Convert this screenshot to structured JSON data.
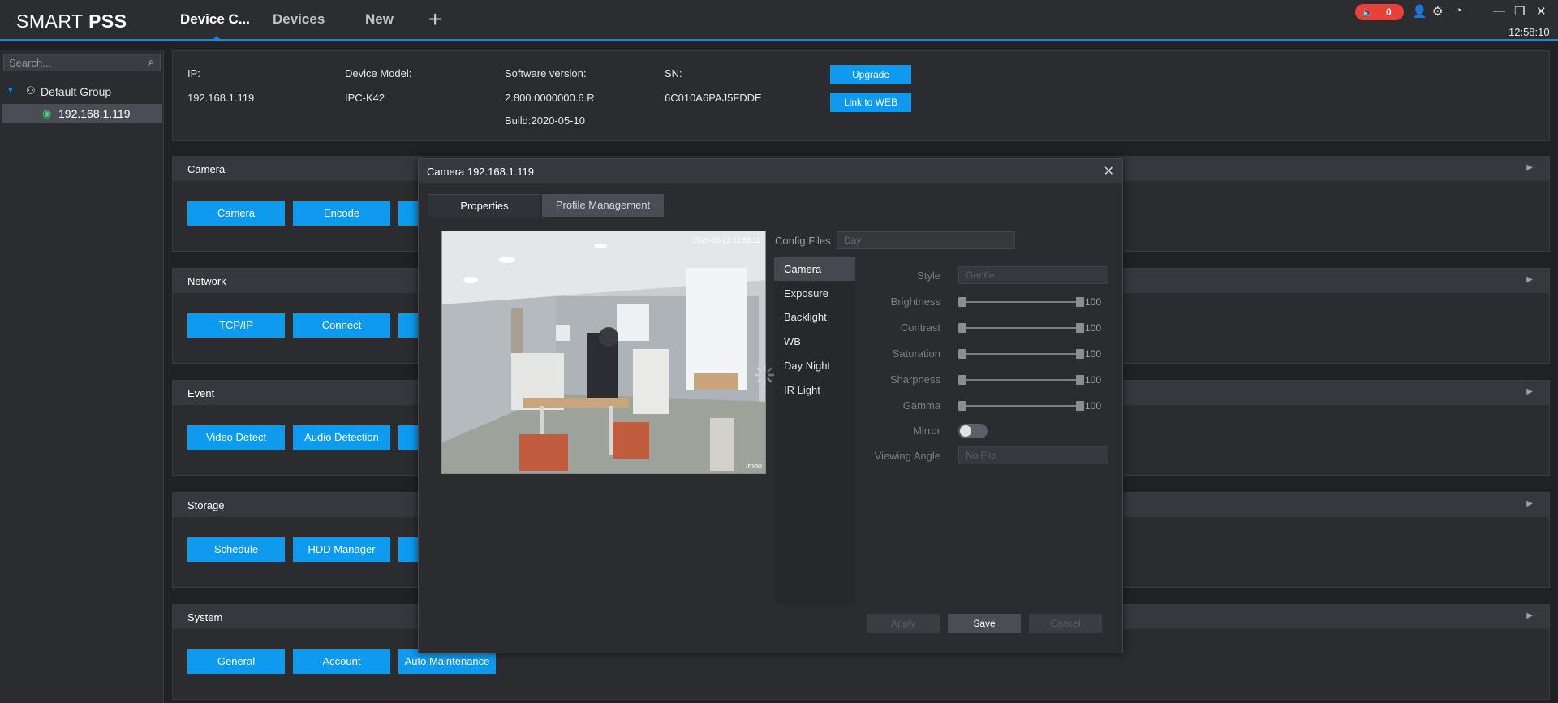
{
  "app": {
    "logo_light": "SMART ",
    "logo_bold": "PSS",
    "tabs": [
      {
        "label": "Device C..."
      },
      {
        "label": "Devices"
      },
      {
        "label": "New"
      }
    ],
    "alarm_count": "0",
    "clock": "12:58:10"
  },
  "sidebar": {
    "search_placeholder": "Search...",
    "group_label": "Default Group",
    "device_label": "192.168.1.119"
  },
  "device_info": {
    "ip_label": "IP:",
    "ip_value": "192.168.1.119",
    "model_label": "Device Model:",
    "model_value": "IPC-K42",
    "sw_label": "Software version:",
    "sw_value": "2.800.0000000.6.R",
    "build_value": "Build:2020-05-10",
    "sn_label": "SN:",
    "sn_value": "6C010A6PAJ5FDDE",
    "upgrade_label": "Upgrade",
    "web_label": "Link to WEB"
  },
  "sections": [
    {
      "title": "Camera",
      "buttons": [
        "Camera",
        "Encode"
      ]
    },
    {
      "title": "Network",
      "buttons": [
        "TCP/IP",
        "Connect"
      ]
    },
    {
      "title": "Event",
      "buttons": [
        "Video Detect",
        "Audio Detection"
      ]
    },
    {
      "title": "Storage",
      "buttons": [
        "Schedule",
        "HDD Manager"
      ]
    },
    {
      "title": "System",
      "buttons": [
        "General",
        "Account",
        "Auto Maintenance"
      ]
    }
  ],
  "dialog": {
    "title": "Camera 192.168.1.119",
    "tab_properties": "Properties",
    "tab_profile": "Profile Management",
    "cam_timestamp": "2020-06-23 12:58:11",
    "cam_tag": "Imou",
    "config_files_label": "Config Files",
    "config_files_value": "Day",
    "menu": [
      "Camera",
      "Exposure",
      "Backlight",
      "WB",
      "Day  Night",
      "IR Light"
    ],
    "style_label": "Style",
    "style_value": "Gentle",
    "params": [
      {
        "label": "Brightness",
        "value": "100"
      },
      {
        "label": "Contrast",
        "value": "100"
      },
      {
        "label": "Saturation",
        "value": "100"
      },
      {
        "label": "Sharpness",
        "value": "100"
      },
      {
        "label": "Gamma",
        "value": "100"
      }
    ],
    "mirror_label": "Mirror",
    "mirror_on": false,
    "viewing_angle_label": "Viewing Angle",
    "viewing_angle_value": "No Flip",
    "apply_label": "Apply",
    "save_label": "Save",
    "cancel_label": "Cancel"
  },
  "colors": {
    "accent": "#0d9aef",
    "alarm": "#e8413c",
    "online": "#3fd07a"
  }
}
